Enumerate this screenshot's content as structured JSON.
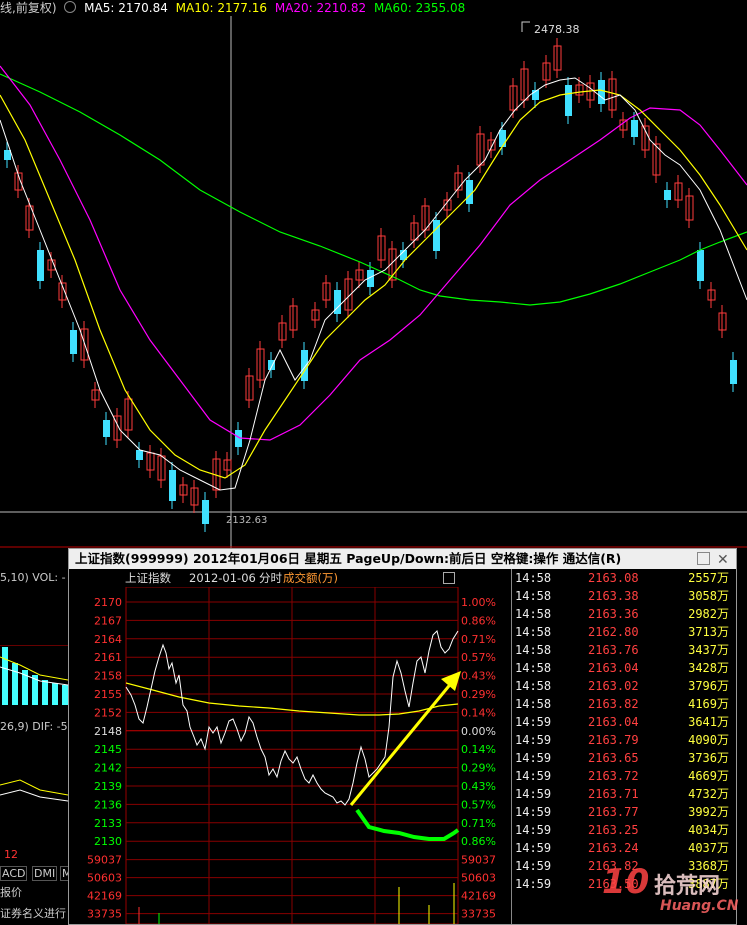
{
  "topbar": {
    "mode": "线,前复权)",
    "ma5": "MA5: 2170.84",
    "ma10": "MA10: 2177.16",
    "ma20": "MA20: 2210.82",
    "ma60": "MA60: 2355.08",
    "colors": {
      "ma5": "#ffffff",
      "ma10": "#ffff00",
      "ma20": "#ff00ff",
      "ma60": "#00ff00"
    }
  },
  "kline": {
    "high_label": "2478.38",
    "low_label": "2132.63"
  },
  "left_panel": {
    "vol_label": "5,10)  VOL: -",
    "macd_label": "26,9)  DIF: -5",
    "num": "12",
    "tabs": [
      "ACD",
      "DMI",
      "M"
    ],
    "report": "报价",
    "footer": "证券名义进行"
  },
  "popup": {
    "title": "上证指数(999999)  2012年01月06日 星期五  PageUp/Down:前后日  空格键:操作  通达信(R)",
    "index_name": "上证指数",
    "date": "2012-01-06",
    "chart_kind": "分时",
    "metric": "成交额(万)",
    "price_axis": [
      "2170",
      "2167",
      "2164",
      "2161",
      "2158",
      "2155",
      "2152",
      "2148",
      "2145",
      "2142",
      "2139",
      "2136",
      "2133",
      "2130"
    ],
    "pct_axis": [
      "1.00%",
      "0.86%",
      "0.71%",
      "0.57%",
      "0.43%",
      "0.29%",
      "0.14%",
      "0.00%",
      "0.14%",
      "0.29%",
      "0.43%",
      "0.57%",
      "0.71%",
      "0.86%"
    ],
    "vol_axis": [
      "59037",
      "50603",
      "42169",
      "33735"
    ],
    "colors": {
      "up": "#ff3030",
      "down": "#00ff00",
      "price_line": "#ffffff",
      "avg_line": "#ffff00",
      "arrow": "#ffff00"
    }
  },
  "ticks": [
    {
      "time": "14:58",
      "price": "2163.08",
      "vol": "2557万"
    },
    {
      "time": "14:58",
      "price": "2163.38",
      "vol": "3058万"
    },
    {
      "time": "14:58",
      "price": "2163.36",
      "vol": "2982万"
    },
    {
      "time": "14:58",
      "price": "2162.80",
      "vol": "3713万"
    },
    {
      "time": "14:58",
      "price": "2163.76",
      "vol": "3437万"
    },
    {
      "time": "14:58",
      "price": "2163.04",
      "vol": "3428万"
    },
    {
      "time": "14:58",
      "price": "2163.02",
      "vol": "3796万"
    },
    {
      "time": "14:58",
      "price": "2163.82",
      "vol": "4169万"
    },
    {
      "time": "14:59",
      "price": "2163.04",
      "vol": "3641万"
    },
    {
      "time": "14:59",
      "price": "2163.79",
      "vol": "4090万"
    },
    {
      "time": "14:59",
      "price": "2163.65",
      "vol": "3736万"
    },
    {
      "time": "14:59",
      "price": "2163.72",
      "vol": "4669万"
    },
    {
      "time": "14:59",
      "price": "2163.71",
      "vol": "4732万"
    },
    {
      "time": "14:59",
      "price": "2163.77",
      "vol": "3992万"
    },
    {
      "time": "14:59",
      "price": "2163.25",
      "vol": "4034万"
    },
    {
      "time": "14:59",
      "price": "2163.24",
      "vol": "4037万"
    },
    {
      "time": "14:59",
      "price": "2163.82",
      "vol": "3368万"
    },
    {
      "time": "14:59",
      "price": "2163.50",
      "vol": "3887万"
    }
  ],
  "watermark": {
    "cn": "拾荒网",
    "en": "Huang.CN",
    "num": "10"
  }
}
